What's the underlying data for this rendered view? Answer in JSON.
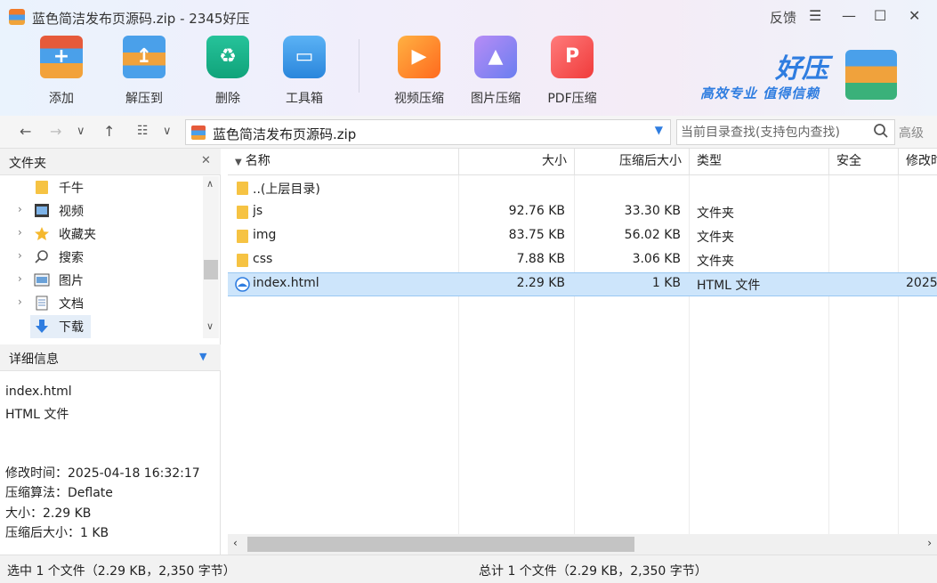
{
  "window": {
    "title": "蓝色简洁发布页源码.zip - 2345好压",
    "feedback": "反馈",
    "menu_glyph": "☰",
    "minimize_glyph": "—",
    "maximize_glyph": "☐",
    "close_glyph": "✕"
  },
  "toolbar": {
    "add": "添加",
    "extract": "解压到",
    "delete": "删除",
    "tools": "工具箱",
    "video": "视频压缩",
    "image": "图片压缩",
    "pdf": "PDF压缩"
  },
  "brand": {
    "name": "好压",
    "slogan": "高效专业 值得信赖"
  },
  "address": {
    "path": "蓝色简洁发布页源码.zip",
    "search_placeholder": "当前目录查找(支持包内查找)",
    "advanced": "高级"
  },
  "sidebar": {
    "header": "文件夹",
    "close_glyph": "✕",
    "items": [
      {
        "label": "千牛",
        "icon": "folder-icon"
      },
      {
        "label": "视频",
        "icon": "video-folder-icon"
      },
      {
        "label": "收藏夹",
        "icon": "star-icon"
      },
      {
        "label": "搜索",
        "icon": "search-icon"
      },
      {
        "label": "图片",
        "icon": "picture-folder-icon"
      },
      {
        "label": "文档",
        "icon": "document-folder-icon"
      },
      {
        "label": "下载",
        "icon": "download-icon"
      }
    ]
  },
  "details": {
    "header": "详细信息",
    "name": "index.html",
    "type": "HTML 文件",
    "modified": "修改时间：2025-04-18 16:32:17",
    "method": "压缩算法：Deflate",
    "size": "大小：2.29 KB",
    "packed": "压缩后大小：1 KB"
  },
  "columns": {
    "name": "名称",
    "size": "大小",
    "packed": "压缩后大小",
    "type": "类型",
    "security": "安全",
    "modified": "修改时"
  },
  "files": [
    {
      "name": "..(上层目录)",
      "size": "",
      "packed": "",
      "type": "",
      "modified": ""
    },
    {
      "name": "js",
      "size": "92.76 KB",
      "packed": "33.30 KB",
      "type": "文件夹",
      "modified": ""
    },
    {
      "name": "img",
      "size": "83.75 KB",
      "packed": "56.02 KB",
      "type": "文件夹",
      "modified": ""
    },
    {
      "name": "css",
      "size": "7.88 KB",
      "packed": "3.06 KB",
      "type": "文件夹",
      "modified": ""
    },
    {
      "name": "index.html",
      "size": "2.29 KB",
      "packed": "1 KB",
      "type": "HTML 文件",
      "modified": "2025"
    }
  ],
  "status": {
    "selected": "选中 1 个文件（2.29 KB，2,350 字节）",
    "total": "总计 1 个文件（2.29 KB，2,350 字节）"
  },
  "colors": {
    "accent": "#2f7de0",
    "selection": "#cde5fb",
    "folder": "#f6c343"
  }
}
